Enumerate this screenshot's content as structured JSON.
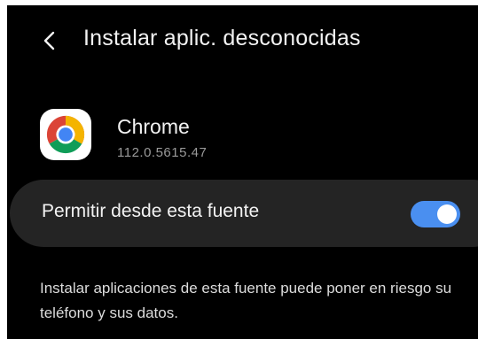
{
  "header": {
    "title": "Instalar aplic. desconocidas",
    "back_icon": "chevron-left-icon"
  },
  "app": {
    "name": "Chrome",
    "version": "112.0.5615.47",
    "icon": "chrome-icon"
  },
  "permission": {
    "label": "Permitir desde esta fuente",
    "enabled": true,
    "accent_color": "#4a8ff0"
  },
  "warning": {
    "text": "Instalar aplicaciones de esta fuente puede poner en riesgo su teléfono y sus datos."
  }
}
